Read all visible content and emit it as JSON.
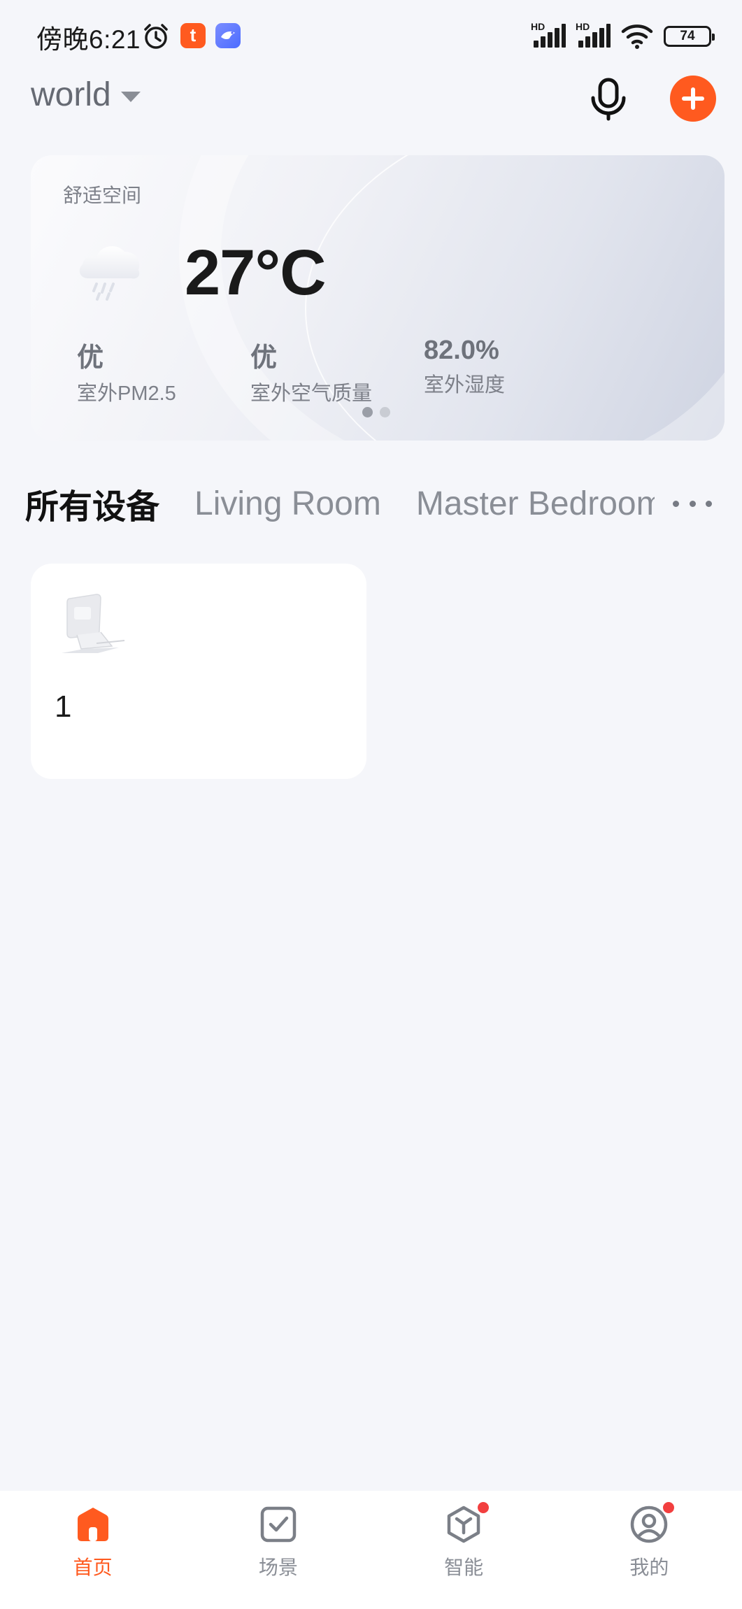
{
  "status_bar": {
    "time": "傍晚6:21",
    "tuya_icon_letter": "t",
    "hd_label_1": "HD",
    "hd_label_2": "HD",
    "battery": "74"
  },
  "header": {
    "home_name": "world"
  },
  "weather_card": {
    "title": "舒适空间",
    "weather_icon": "cloud-rain-icon",
    "temperature": "27°C",
    "stats": [
      {
        "value": "优",
        "label": "室外PM2.5"
      },
      {
        "value": "优",
        "label": "室外空气质量"
      },
      {
        "value": "82.0%",
        "label": "室外湿度"
      }
    ],
    "page_count": 2,
    "active_page": 0
  },
  "room_tabs": [
    {
      "label": "所有设备",
      "active": true
    },
    {
      "label": "Living Room",
      "active": false
    },
    {
      "label": "Master Bedroom",
      "active": false
    }
  ],
  "devices": [
    {
      "name": "1",
      "icon": "thermostat-device-icon"
    }
  ],
  "bottom_nav": [
    {
      "label": "首页",
      "icon": "home-icon",
      "active": true,
      "badge": false
    },
    {
      "label": "场景",
      "icon": "scene-check-icon",
      "active": false,
      "badge": false
    },
    {
      "label": "智能",
      "icon": "smart-cube-icon",
      "active": false,
      "badge": true
    },
    {
      "label": "我的",
      "icon": "profile-icon",
      "active": false,
      "badge": true
    }
  ],
  "colors": {
    "accent": "#ff5a1f",
    "badge": "#f23f3f",
    "background": "#f5f6fa"
  }
}
